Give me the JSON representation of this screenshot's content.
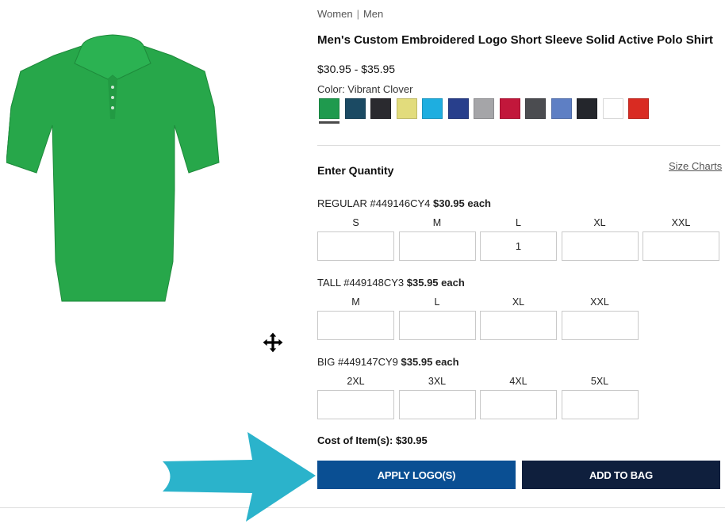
{
  "breadcrumb": {
    "women": "Women",
    "separator": "|",
    "men": "Men"
  },
  "product": {
    "title": "Men's Custom Embroidered Logo Short Sleeve Solid Active Polo Shirt",
    "price_range": "$30.95 - $35.95",
    "color_label": "Color: Vibrant Clover",
    "image_color": "#27a74a",
    "swatches": [
      {
        "name": "Vibrant Clover",
        "hex": "#1f9a4e",
        "selected": true
      },
      {
        "name": "teal",
        "hex": "#1b4a63",
        "selected": false
      },
      {
        "name": "black",
        "hex": "#2a2a2f",
        "selected": false
      },
      {
        "name": "yellow",
        "hex": "#e2dc7c",
        "selected": false
      },
      {
        "name": "cyan",
        "hex": "#1eaee0",
        "selected": false
      },
      {
        "name": "royal",
        "hex": "#283f8c",
        "selected": false
      },
      {
        "name": "grey",
        "hex": "#a5a5a8",
        "selected": false
      },
      {
        "name": "red",
        "hex": "#c2173b",
        "selected": false
      },
      {
        "name": "charcoal",
        "hex": "#4b4c50",
        "selected": false
      },
      {
        "name": "periwinkle",
        "hex": "#5e7fc4",
        "selected": false
      },
      {
        "name": "navy-black",
        "hex": "#24262c",
        "selected": false
      },
      {
        "name": "white",
        "hex": "#ffffff",
        "selected": false
      },
      {
        "name": "orange-red",
        "hex": "#d92b22",
        "selected": false
      }
    ]
  },
  "quantity": {
    "heading": "Enter Quantity",
    "size_charts": "Size Charts",
    "groups": [
      {
        "label": "REGULAR #449146CY4",
        "price": "$30.95 each",
        "sizes": [
          {
            "size": "S",
            "value": ""
          },
          {
            "size": "M",
            "value": ""
          },
          {
            "size": "L",
            "value": "1"
          },
          {
            "size": "XL",
            "value": ""
          },
          {
            "size": "XXL",
            "value": ""
          }
        ]
      },
      {
        "label": "TALL #449148CY3",
        "price": "$35.95 each",
        "sizes": [
          {
            "size": "M",
            "value": ""
          },
          {
            "size": "L",
            "value": ""
          },
          {
            "size": "XL",
            "value": ""
          },
          {
            "size": "XXL",
            "value": ""
          }
        ]
      },
      {
        "label": "BIG #449147CY9",
        "price": "$35.95 each",
        "sizes": [
          {
            "size": "2XL",
            "value": ""
          },
          {
            "size": "3XL",
            "value": ""
          },
          {
            "size": "4XL",
            "value": ""
          },
          {
            "size": "5XL",
            "value": ""
          }
        ]
      }
    ]
  },
  "cost": "Cost of Item(s): $30.95",
  "buttons": {
    "apply_logo": "APPLY LOGO(S)",
    "add_to_bag": "ADD TO BAG"
  },
  "colors": {
    "apply_button": "#0a4f93",
    "bag_button": "#0f1f3d",
    "arrow": "#2bb3cb"
  },
  "icons": {
    "cursor": "move-cursor-icon",
    "pointer": "arrow-annotation"
  }
}
